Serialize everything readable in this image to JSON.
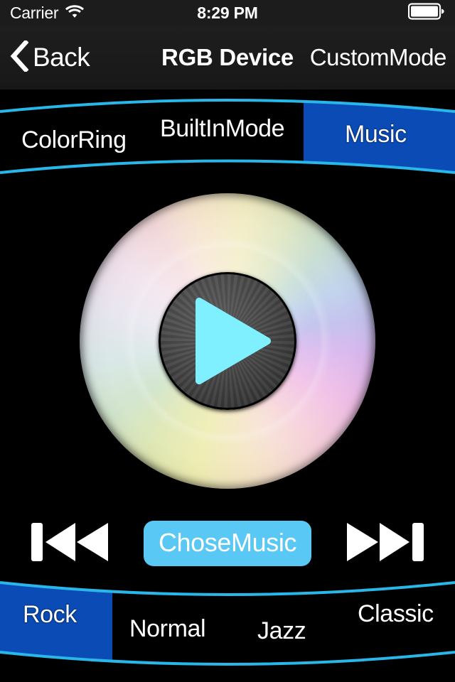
{
  "status_bar": {
    "carrier": "Carrier",
    "wifi_icon": "wifi-icon",
    "time": "8:29 PM",
    "battery_icon": "battery-full-icon"
  },
  "nav_bar": {
    "back_icon": "chevron-left-icon",
    "back_label": "Back",
    "title": "RGB Device",
    "right_button": "CustomMode"
  },
  "top_tabs": {
    "items": [
      {
        "label": "ColorRing",
        "selected": false
      },
      {
        "label": "BuiltInMode",
        "selected": false
      },
      {
        "label": "Music",
        "selected": true
      }
    ]
  },
  "player": {
    "disc_icon": "cd-disc-icon",
    "play_icon": "play-icon",
    "prev_icon": "previous-track-icon",
    "next_icon": "next-track-icon",
    "chose_music_label": "ChoseMusic"
  },
  "bottom_tabs": {
    "items": [
      {
        "label": "Rock",
        "selected": true
      },
      {
        "label": "Normal",
        "selected": false
      },
      {
        "label": "Jazz",
        "selected": false
      },
      {
        "label": "Classic",
        "selected": false
      }
    ]
  },
  "colors": {
    "accent_cyan": "#29b6e8",
    "selected_tab_blue": "#0a4bb5",
    "button_blue": "#5ac8f5",
    "play_triangle": "#7ef0ff",
    "nav_background": "#1c1c1c",
    "page_background": "#000000"
  }
}
